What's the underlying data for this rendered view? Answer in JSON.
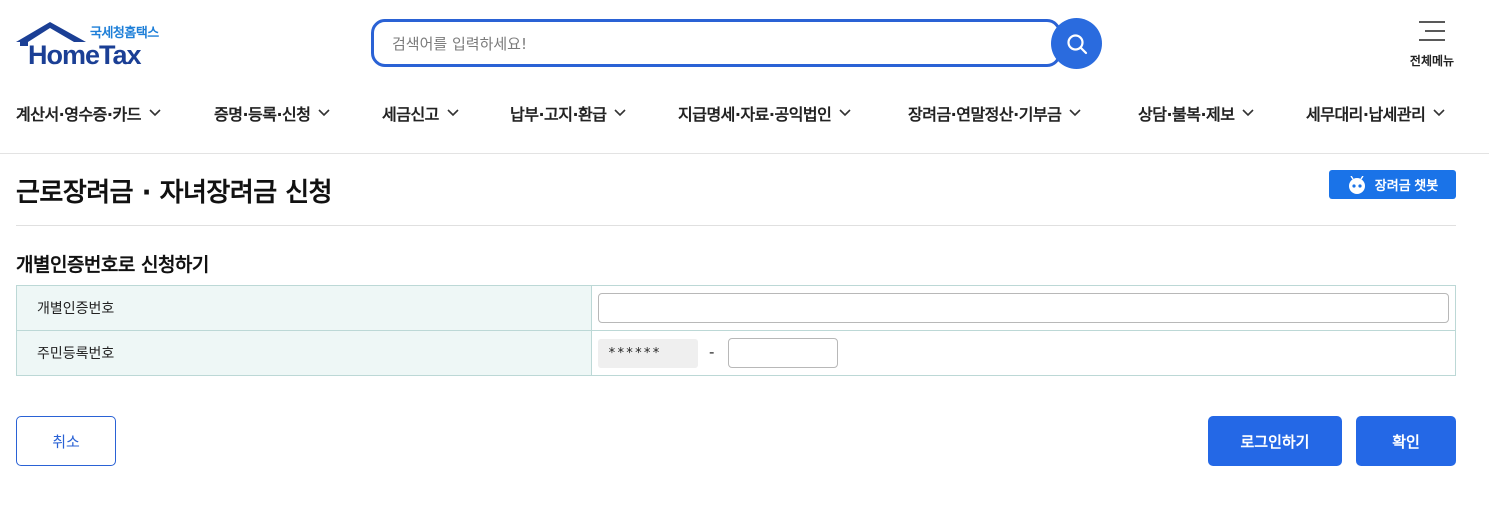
{
  "brand": {
    "sub": "국세청홈택스",
    "main": "HomeTax",
    "primary_color": "#1b3f95",
    "accent_color": "#2a62d5"
  },
  "search": {
    "placeholder": "검색어를 입력하세요!",
    "value": "",
    "icon": "search-icon"
  },
  "menu_all": {
    "label": "전체메뉴",
    "icon": "hamburger-icon"
  },
  "gnb": {
    "items": [
      {
        "label": "계산서·영수증·카드"
      },
      {
        "label": "증명·등록·신청"
      },
      {
        "label": "세금신고"
      },
      {
        "label": "납부·고지·환급"
      },
      {
        "label": "지급명세·자료·공익법인"
      },
      {
        "label": "장려금·연말정산·기부금"
      },
      {
        "label": "상담·불복·제보"
      },
      {
        "label": "세무대리·납세관리"
      }
    ],
    "chevron_icon": "chevron-down-icon"
  },
  "page": {
    "title": "근로장려금 · 자녀장려금 신청",
    "chatbot_label": "장려금 챗봇",
    "chatbot_icon": "chatbot-icon"
  },
  "form": {
    "section_title": "개별인증번호로 신청하기",
    "rows": [
      {
        "label": "개별인증번호",
        "value": ""
      },
      {
        "label": "주민등록번호",
        "front_masked": "******",
        "dash": "-",
        "back_value": ""
      }
    ]
  },
  "buttons": {
    "cancel": "취소",
    "login": "로그인하기",
    "confirm": "확인"
  }
}
